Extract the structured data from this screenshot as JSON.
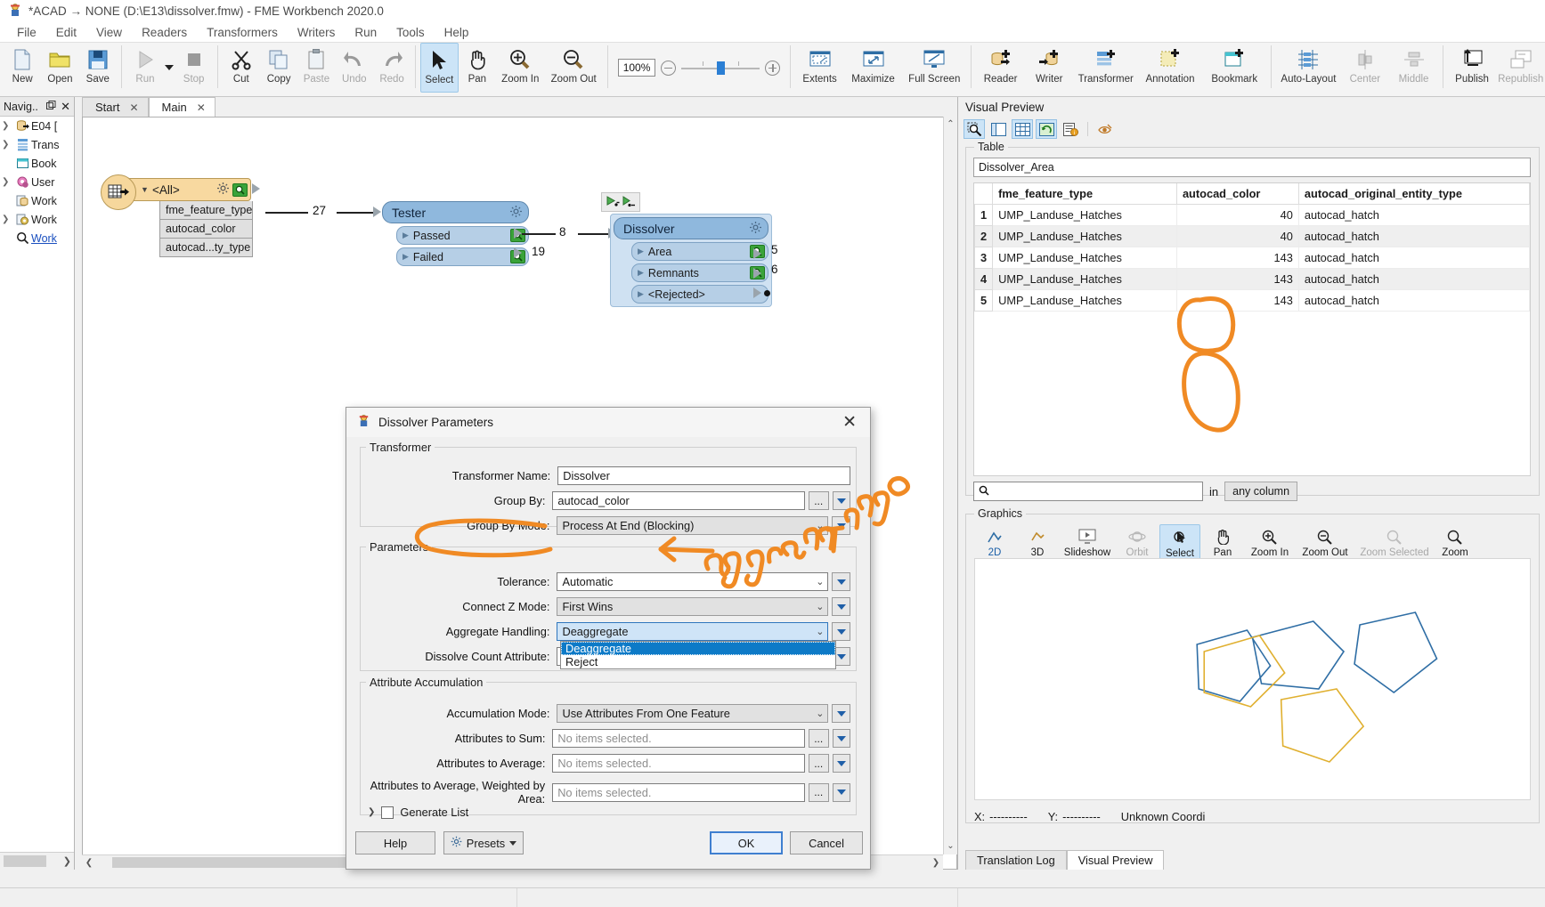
{
  "window": {
    "title": "*ACAD → NONE (D:\\E13\\dissolver.fmw) - FME Workbench 2020.0",
    "icon": "fme-app-icon"
  },
  "menubar": {
    "items": [
      "File",
      "Edit",
      "View",
      "Readers",
      "Transformers",
      "Writers",
      "Run",
      "Tools",
      "Help"
    ]
  },
  "toolbar": {
    "groups": [
      {
        "buttons": [
          {
            "label": "New",
            "icon": "new-document-icon",
            "state": "normal"
          },
          {
            "label": "Open",
            "icon": "open-folder-icon",
            "state": "normal"
          },
          {
            "label": "Save",
            "icon": "save-disk-icon",
            "state": "normal"
          }
        ]
      },
      {
        "buttons": [
          {
            "label": "Run",
            "icon": "run-play-icon",
            "state": "disabled"
          },
          {
            "label": "Stop",
            "icon": "stop-square-icon",
            "state": "disabled"
          }
        ]
      },
      {
        "buttons": [
          {
            "label": "Cut",
            "icon": "scissors-icon",
            "state": "normal"
          },
          {
            "label": "Copy",
            "icon": "copy-icon",
            "state": "normal"
          },
          {
            "label": "Paste",
            "icon": "clipboard-icon",
            "state": "disabled"
          },
          {
            "label": "Undo",
            "icon": "undo-arrow-icon",
            "state": "disabled"
          },
          {
            "label": "Redo",
            "icon": "redo-arrow-icon",
            "state": "disabled"
          }
        ]
      },
      {
        "buttons": [
          {
            "label": "Select",
            "icon": "cursor-arrow-icon",
            "state": "selected"
          },
          {
            "label": "Pan",
            "icon": "hand-icon",
            "state": "normal"
          },
          {
            "label": "Zoom In",
            "icon": "zoom-in-icon",
            "state": "normal"
          },
          {
            "label": "Zoom Out",
            "icon": "zoom-out-icon",
            "state": "normal"
          }
        ]
      },
      {
        "buttons": [
          {
            "label": "Extents",
            "icon": "extents-icon",
            "state": "normal"
          },
          {
            "label": "Maximize",
            "icon": "maximize-icon",
            "state": "normal"
          },
          {
            "label": "Full Screen",
            "icon": "full-screen-icon",
            "state": "normal"
          }
        ]
      },
      {
        "buttons": [
          {
            "label": "Reader",
            "icon": "add-reader-icon",
            "state": "normal"
          },
          {
            "label": "Writer",
            "icon": "add-writer-icon",
            "state": "normal"
          },
          {
            "label": "Transformer",
            "icon": "add-transformer-icon",
            "state": "normal"
          },
          {
            "label": "Annotation",
            "icon": "add-annotation-icon",
            "state": "normal"
          },
          {
            "label": "Bookmark",
            "icon": "add-bookmark-icon",
            "state": "normal"
          }
        ]
      },
      {
        "buttons": [
          {
            "label": "Auto-Layout",
            "icon": "auto-layout-icon",
            "state": "normal"
          },
          {
            "label": "Center",
            "icon": "align-center-icon",
            "state": "disabled"
          },
          {
            "label": "Middle",
            "icon": "align-middle-icon",
            "state": "disabled"
          }
        ]
      },
      {
        "buttons": [
          {
            "label": "Publish",
            "icon": "publish-icon",
            "state": "normal"
          },
          {
            "label": "Republish",
            "icon": "republish-icon",
            "state": "disabled"
          }
        ]
      }
    ],
    "zoom": {
      "value": "100%",
      "minus": "−",
      "plus": "+"
    }
  },
  "navigator": {
    "title": "Navig..",
    "items": [
      {
        "label": "E04 [",
        "icon": "reader-db-icon",
        "expandable": true,
        "link": false
      },
      {
        "label": "Trans",
        "icon": "transformer-icon",
        "expandable": true,
        "link": false
      },
      {
        "label": "Book",
        "icon": "bookmark-icon",
        "expandable": false,
        "link": false
      },
      {
        "label": "User ",
        "icon": "user-parameters-icon",
        "expandable": true,
        "link": false
      },
      {
        "label": "Work",
        "icon": "workspace-resources-icon",
        "expandable": false,
        "link": false
      },
      {
        "label": "Work",
        "icon": "workspace-settings-icon",
        "expandable": true,
        "link": false
      },
      {
        "label": "Work",
        "icon": "search-icon",
        "expandable": false,
        "link": true
      }
    ]
  },
  "tabs": [
    {
      "label": "Start",
      "active": false
    },
    {
      "label": "Main",
      "active": true
    }
  ],
  "canvas": {
    "reader": {
      "title": "<All>",
      "icon": "reader-table-icon",
      "attributes": [
        "fme_feature_type",
        "autocad_color",
        "autocad...ty_type"
      ],
      "out_count": "27"
    },
    "tester": {
      "title": "Tester",
      "ports": [
        {
          "label": "Passed",
          "count": "8"
        },
        {
          "label": "Failed",
          "count": "19"
        }
      ]
    },
    "dissolver": {
      "title": "Dissolver",
      "ports": [
        {
          "label": "Area",
          "count": "5"
        },
        {
          "label": "Remnants",
          "count": "6"
        },
        {
          "label": "<Rejected>",
          "count": ""
        }
      ],
      "badge_icon": "feature-caching-icon"
    }
  },
  "dialog": {
    "title": "Dissolver Parameters",
    "icon": "fme-dialog-icon",
    "close_icon": "close-icon",
    "sections": [
      {
        "legend": "Transformer",
        "fields": [
          {
            "label": "Transformer Name:",
            "value": "Dissolver",
            "kind": "text"
          },
          {
            "label": "Group By:",
            "value": "autocad_color",
            "kind": "text-with-picker"
          },
          {
            "label": "Group By Mode:",
            "value": "Process At End (Blocking)",
            "kind": "combo-readonly"
          }
        ]
      },
      {
        "legend": "Parameters",
        "fields": [
          {
            "label": "Tolerance:",
            "value": "Automatic",
            "kind": "combo"
          },
          {
            "label": "Connect Z Mode:",
            "value": "First Wins",
            "kind": "combo-readonly"
          },
          {
            "label": "Aggregate Handling:",
            "value": "Deaggregate",
            "kind": "combo-open"
          },
          {
            "label": "Dissolve Count Attribute:",
            "value": "",
            "kind": "text"
          }
        ]
      },
      {
        "legend": "Attribute Accumulation",
        "fields": [
          {
            "label": "Accumulation Mode:",
            "value": "Use Attributes From One Feature",
            "kind": "combo-readonly"
          },
          {
            "label": "Attributes to Sum:",
            "value": "",
            "placeholder": "No items selected.",
            "kind": "picker"
          },
          {
            "label": "Attributes to Average:",
            "value": "",
            "placeholder": "No items selected.",
            "kind": "picker"
          },
          {
            "label": "Attributes to Average, Weighted by Area:",
            "value": "",
            "placeholder": "No items selected.",
            "kind": "picker"
          }
        ]
      }
    ],
    "dropdown": {
      "open": true,
      "options": [
        "Deaggregate",
        "Reject"
      ],
      "selected": "Deaggregate"
    },
    "generate_list": {
      "label": "Generate List",
      "checked": false
    },
    "buttons": {
      "help": "Help",
      "presets": "Presets",
      "ok": "OK",
      "cancel": "Cancel"
    }
  },
  "visual_preview": {
    "title": "Visual Preview",
    "toolbar_icons": [
      {
        "name": "inspect-icon",
        "on": true
      },
      {
        "name": "layout-panes-icon",
        "on": false
      },
      {
        "name": "table-view-icon",
        "on": true
      },
      {
        "name": "refresh-icon",
        "on": true
      },
      {
        "name": "feature-info-icon",
        "on": false
      },
      {
        "name": "eye-select-icon",
        "on": false
      }
    ],
    "table_group_label": "Table",
    "dataset": "Dissolver_Area",
    "columns": [
      "fme_feature_type",
      "autocad_color",
      "autocad_original_entity_type"
    ],
    "rows": [
      {
        "index": "1",
        "fme_feature_type": "UMP_Landuse_Hatches",
        "autocad_color": "40",
        "autocad_original_entity_type": "autocad_hatch"
      },
      {
        "index": "2",
        "fme_feature_type": "UMP_Landuse_Hatches",
        "autocad_color": "40",
        "autocad_original_entity_type": "autocad_hatch"
      },
      {
        "index": "3",
        "fme_feature_type": "UMP_Landuse_Hatches",
        "autocad_color": "143",
        "autocad_original_entity_type": "autocad_hatch"
      },
      {
        "index": "4",
        "fme_feature_type": "UMP_Landuse_Hatches",
        "autocad_color": "143",
        "autocad_original_entity_type": "autocad_hatch"
      },
      {
        "index": "5",
        "fme_feature_type": "UMP_Landuse_Hatches",
        "autocad_color": "143",
        "autocad_original_entity_type": "autocad_hatch"
      }
    ],
    "search": {
      "placeholder": "",
      "icon": "search-icon",
      "in_label": "in",
      "column_scope": "any column"
    },
    "graphics_group_label": "Graphics",
    "graphics_buttons": [
      {
        "label": "2D",
        "icon": "view-2d-icon",
        "state": "selected-text"
      },
      {
        "label": "3D",
        "icon": "view-3d-icon",
        "state": "normal"
      },
      {
        "label": "Slideshow",
        "icon": "slideshow-icon",
        "state": "normal"
      },
      {
        "label": "Orbit",
        "icon": "orbit-icon",
        "state": "disabled"
      },
      {
        "label": "Select",
        "icon": "select-icon",
        "state": "selected"
      },
      {
        "label": "Pan",
        "icon": "pan-hand-icon",
        "state": "normal"
      },
      {
        "label": "Zoom In",
        "icon": "zoom-in-icon",
        "state": "normal"
      },
      {
        "label": "Zoom Out",
        "icon": "zoom-out-icon",
        "state": "normal"
      },
      {
        "label": "Zoom Selected",
        "icon": "zoom-selected-icon",
        "state": "disabled"
      },
      {
        "label": "Zoom",
        "icon": "zoom-icon",
        "state": "normal"
      }
    ],
    "status": {
      "x_label": "X:",
      "x_value": "----------",
      "y_label": "Y:",
      "y_value": "----------",
      "coord_text": "Unknown Coordi"
    }
  },
  "bottom_tabs": [
    {
      "label": "Translation Log",
      "active": false
    },
    {
      "label": "Visual Preview",
      "active": true
    }
  ],
  "annotations": {
    "handwriting_text": "aggregating",
    "ink_color": "#f08a24"
  }
}
